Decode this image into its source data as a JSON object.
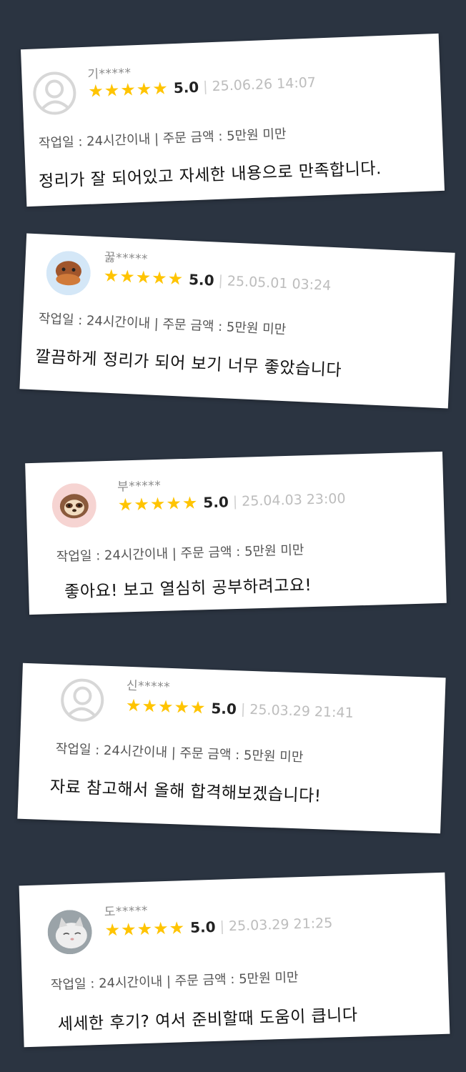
{
  "reviews": [
    {
      "user": "기*****",
      "score": "5.0",
      "separator": "|",
      "date": "25.06.26 14:07",
      "meta": "작업일 : 24시간이내 | 주문 금액 : 5만원 미만",
      "text": "정리가 잘 되어있고 자세한 내용으로 만족합니다.",
      "stars": 5,
      "avatar": "default-avatar-icon"
    },
    {
      "user": "꿇*****",
      "score": "5.0",
      "separator": "|",
      "date": "25.05.01 03:24",
      "meta": "작업일 : 24시간이내 | 주문 금액 : 5만원 미만",
      "text": "깔끔하게 정리가 되어 보기 너무 좋았습니다",
      "stars": 5,
      "avatar": "platypus-avatar-icon"
    },
    {
      "user": "부*****",
      "score": "5.0",
      "separator": "|",
      "date": "25.04.03 23:00",
      "meta": "작업일 : 24시간이내 | 주문 금액 : 5만원 미만",
      "text": "좋아요! 보고 열심히 공부하려고요!",
      "stars": 5,
      "avatar": "sloth-avatar-icon"
    },
    {
      "user": "신*****",
      "score": "5.0",
      "separator": "|",
      "date": "25.03.29 21:41",
      "meta": "작업일 : 24시간이내 | 주문 금액 : 5만원 미만",
      "text": "자료 참고해서 올해 합격해보겠습니다!",
      "stars": 5,
      "avatar": "default-avatar-icon"
    },
    {
      "user": "도*****",
      "score": "5.0",
      "separator": "|",
      "date": "25.03.29 21:25",
      "meta": "작업일 : 24시간이내 | 주문 금액 : 5만원 미만",
      "text": "세세한 후기? 여서 준비할때 도움이 큽니다",
      "stars": 5,
      "avatar": "cat-avatar-icon"
    }
  ],
  "colors": {
    "background": "#2b3441",
    "star": "#ffc400"
  }
}
